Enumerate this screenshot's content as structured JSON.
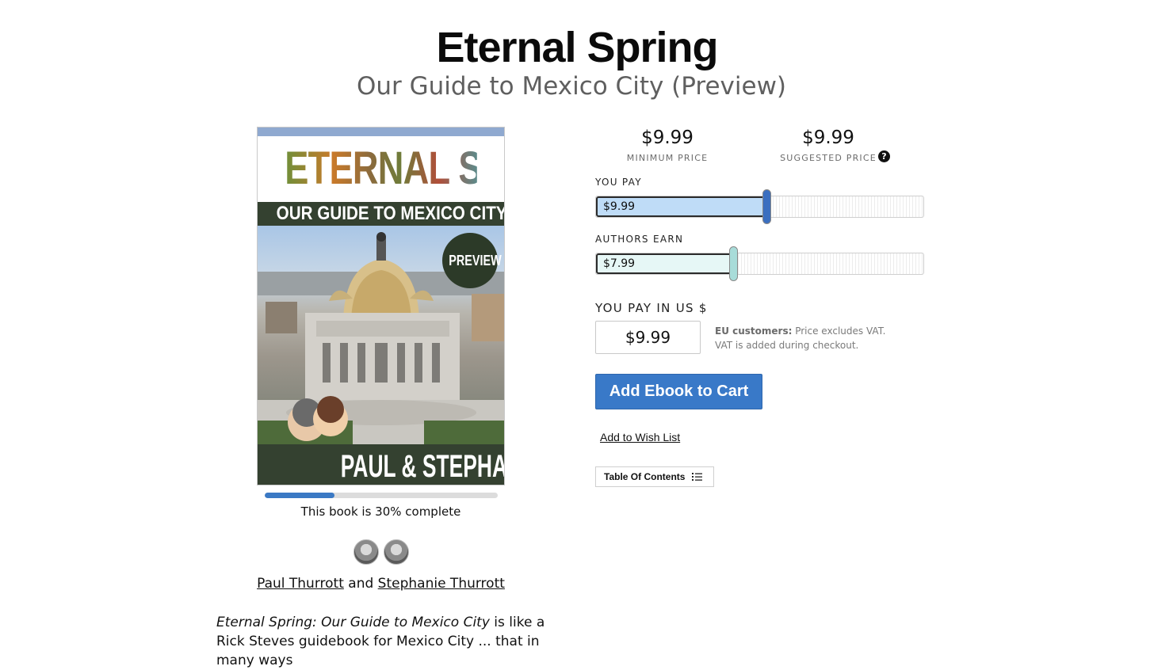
{
  "header": {
    "title": "Eternal Spring",
    "subtitle": "Our Guide to Mexico City (Preview)"
  },
  "cover": {
    "title": "ETERNAL SPRING",
    "subtitle": "OUR GUIDE TO MEXICO CITY",
    "badge": "PREVIEW",
    "authors": "PAUL & STEPHANIE THURROTT"
  },
  "progress": {
    "percent": 30,
    "text": "This book is 30% complete"
  },
  "authors": {
    "first": "Paul Thurrott",
    "joiner": "and",
    "second": "Stephanie Thurrott"
  },
  "description": {
    "italic": "Eternal Spring: Our Guide to Mexico City",
    "text": " is like a Rick Steves guidebook for Mexico City ... that in many ways"
  },
  "pricing": {
    "minimum_price": "$9.99",
    "minimum_label": "MINIMUM PRICE",
    "suggested_price": "$9.99",
    "suggested_label": "SUGGESTED PRICE",
    "help_icon": "question-circle-icon",
    "you_pay_label": "YOU PAY",
    "you_pay_value": "$9.99",
    "you_pay_fraction": 0.52,
    "authors_earn_label": "AUTHORS EARN",
    "authors_earn_value": "$7.99",
    "authors_earn_fraction": 0.42,
    "usd_label": "YOU PAY IN US $",
    "usd_value": "$9.99",
    "vat_bold": "EU customers:",
    "vat_text": " Price excludes VAT. VAT is added during checkout.",
    "add_to_cart": "Add Ebook to Cart",
    "wish_list": "Add to Wish List",
    "toc": "Table Of Contents"
  },
  "colors": {
    "accent": "#3979c8",
    "you_pay_fill": "#bfdcf7",
    "you_pay_thumb": "#3b6fc0",
    "earn_fill": "#e6f7f6",
    "earn_thumb": "#a8dcd9"
  }
}
